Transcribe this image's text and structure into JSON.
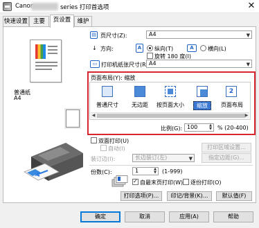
{
  "window": {
    "title_prefix": "Canon",
    "title_suffix": "series 打印首选项",
    "close_glyph": "✕"
  },
  "tabs": [
    {
      "label": "快速设置"
    },
    {
      "label": "主要"
    },
    {
      "label": "页设置"
    },
    {
      "label": "维护"
    }
  ],
  "preview": {
    "media_type": "普通纸",
    "media_size": "A4"
  },
  "page_size": {
    "label": "页尺寸(Z):",
    "value": "A4"
  },
  "orientation": {
    "label": "方向:",
    "portrait": "纵向(T)",
    "landscape": "横向(L)",
    "portrait_icon": "A",
    "landscape_icon": "A",
    "rotate_label": "旋转 180 度(I)"
  },
  "printer_paper_size": {
    "label": "打印机纸张尺寸(R):",
    "value": "A4"
  },
  "layout": {
    "title": "页面布局(Y):  缩放",
    "options": [
      {
        "label": "普通尺寸"
      },
      {
        "label": "无边距"
      },
      {
        "label": "按页面大小"
      },
      {
        "label": "缩放"
      },
      {
        "label": "页面布局"
      }
    ],
    "page_layout_badge": "2",
    "scaling_label": "比例(G):",
    "scaling_value": "100",
    "scaling_range": "% (20-400)"
  },
  "duplex": {
    "label": "双面打印(U)",
    "auto_label": "自动(I)",
    "print_area_button": "打印区域设置...",
    "binding_label": "装订边(I):",
    "binding_value": "长边装订(左)",
    "margin_button": "指定边距(G)..."
  },
  "copies": {
    "label": "份数(C):",
    "value": "1",
    "range": "(1-999)",
    "last_page_first": "自最末页打印(W)",
    "collate": "逐份打印(O)"
  },
  "buttons": {
    "print_options": "打印选项(P)...",
    "stamp_background": "印记/背景(K)...",
    "defaults": "默认值(F)",
    "ok": "确定",
    "cancel": "取消",
    "apply": "应用(A)",
    "help": "帮助"
  },
  "colors": {
    "highlight": "#d8262f",
    "accent": "#1f63c7"
  }
}
